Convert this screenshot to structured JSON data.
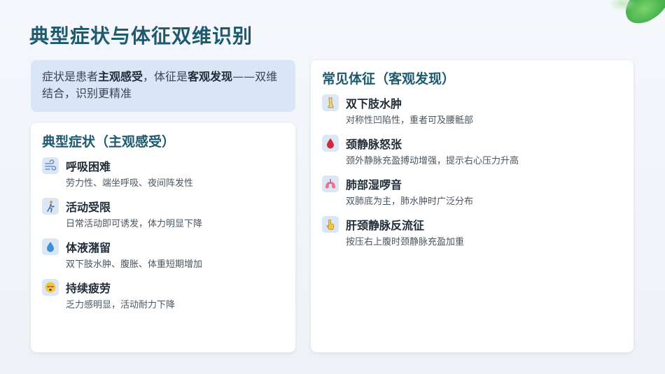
{
  "title": "典型症状与体征双维识别",
  "note": {
    "part1": "症状是患者",
    "bold1": "主观感受",
    "part2": "，体征是",
    "bold2": "客观发现",
    "part3": "——双维结合，识别更精准"
  },
  "symptoms": {
    "heading": "典型症状（主观感受）",
    "items": [
      {
        "title": "呼吸困难",
        "desc": "劳力性、端坐呼吸、夜间阵发性",
        "icon": "wind-icon"
      },
      {
        "title": "活动受限",
        "desc": "日常活动即可诱发，体力明显下降",
        "icon": "walking-person-icon"
      },
      {
        "title": "体液潴留",
        "desc": "双下肢水肿、腹胀、体重短期增加",
        "icon": "droplet-icon"
      },
      {
        "title": "持续疲劳",
        "desc": "乏力感明显，活动耐力下降",
        "icon": "tired-face-icon"
      }
    ]
  },
  "signs": {
    "heading": "常见体征（客观发现）",
    "items": [
      {
        "title": "双下肢水肿",
        "desc": "对称性凹陷性，重者可及腰骶部",
        "icon": "leg-icon"
      },
      {
        "title": "颈静脉怒张",
        "desc": "颈外静脉充盈搏动增强，提示右心压力升高",
        "icon": "blood-drop-icon"
      },
      {
        "title": "肺部湿啰音",
        "desc": "双肺底为主，肺水肿时广泛分布",
        "icon": "lungs-icon"
      },
      {
        "title": "肝颈静脉反流征",
        "desc": "按压右上腹时颈静脉充盈加重",
        "icon": "pointing-hand-icon"
      }
    ]
  }
}
